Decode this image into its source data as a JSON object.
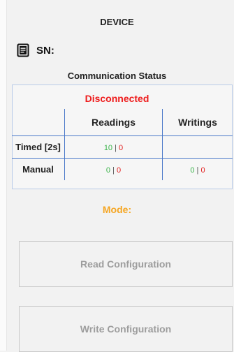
{
  "device": {
    "title": "DEVICE",
    "sn_label": "SN:"
  },
  "communication": {
    "title": "Communication Status",
    "status": "Disconnected",
    "status_color": "#ee1c1c",
    "headers": [
      "",
      "Readings",
      "Writings"
    ],
    "rows": [
      {
        "label": "Timed [2s]",
        "readings": {
          "ok": "10",
          "sep": " | ",
          "err": "0"
        },
        "writings": {
          "ok": "",
          "sep": "",
          "err": ""
        }
      },
      {
        "label": "Manual",
        "readings": {
          "ok": "0",
          "sep": " | ",
          "err": "0"
        },
        "writings": {
          "ok": "0",
          "sep": " | ",
          "err": "0"
        }
      }
    ],
    "ok_color": "#3bb34a",
    "err_color": "#e21f1f"
  },
  "mode": {
    "label": "Mode:",
    "color": "#f5a623"
  },
  "buttons": {
    "read_configuration": "Read Configuration",
    "write_configuration": "Write Configuration"
  },
  "icons": {
    "sn": "document-icon"
  }
}
